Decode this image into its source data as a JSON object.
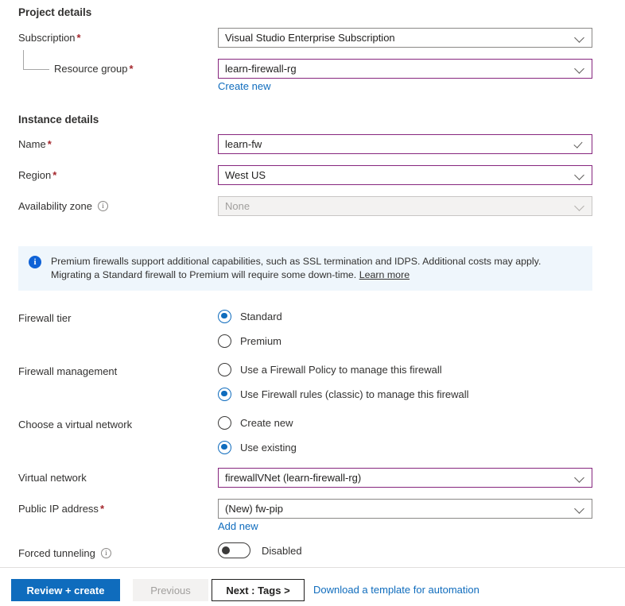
{
  "sections": {
    "project_details": "Project details",
    "instance_details": "Instance details"
  },
  "fields": {
    "subscription": {
      "label": "Subscription",
      "required": "*",
      "value": "Visual Studio Enterprise Subscription"
    },
    "resource_group": {
      "label": "Resource group",
      "required": "*",
      "value": "learn-firewall-rg",
      "create_new_link": "Create new"
    },
    "name": {
      "label": "Name",
      "required": "*",
      "value": "learn-fw"
    },
    "region": {
      "label": "Region",
      "required": "*",
      "value": "West US"
    },
    "availability_zone": {
      "label": "Availability zone",
      "value": "None"
    },
    "virtual_network": {
      "label": "Virtual network",
      "value": "firewallVNet (learn-firewall-rg)"
    },
    "public_ip": {
      "label": "Public IP address",
      "required": "*",
      "value": "(New) fw-pip",
      "add_new_link": "Add new"
    },
    "forced_tunneling": {
      "label": "Forced tunneling",
      "state": "Disabled"
    }
  },
  "banner": {
    "text": "Premium firewalls support additional capabilities, such as SSL termination and IDPS. Additional costs may apply. Migrating a Standard firewall to Premium will require some down-time.",
    "link": "Learn more"
  },
  "radio_groups": {
    "firewall_tier": {
      "label": "Firewall tier",
      "options": [
        {
          "label": "Standard",
          "selected": true
        },
        {
          "label": "Premium",
          "selected": false
        }
      ]
    },
    "firewall_management": {
      "label": "Firewall management",
      "options": [
        {
          "label": "Use a Firewall Policy to manage this firewall",
          "selected": false
        },
        {
          "label": "Use Firewall rules (classic) to manage this firewall",
          "selected": true
        }
      ]
    },
    "choose_vnet": {
      "label": "Choose a virtual network",
      "options": [
        {
          "label": "Create new",
          "selected": false
        },
        {
          "label": "Use existing",
          "selected": true
        }
      ]
    }
  },
  "footer": {
    "review_create": "Review + create",
    "previous": "Previous",
    "next": "Next : Tags >",
    "download_template": "Download a template for automation"
  },
  "colors": {
    "accent_blue": "#0f6cbd",
    "modified_border": "#86267e",
    "required_red": "#a4262c",
    "banner_bg": "#eff6fc"
  }
}
